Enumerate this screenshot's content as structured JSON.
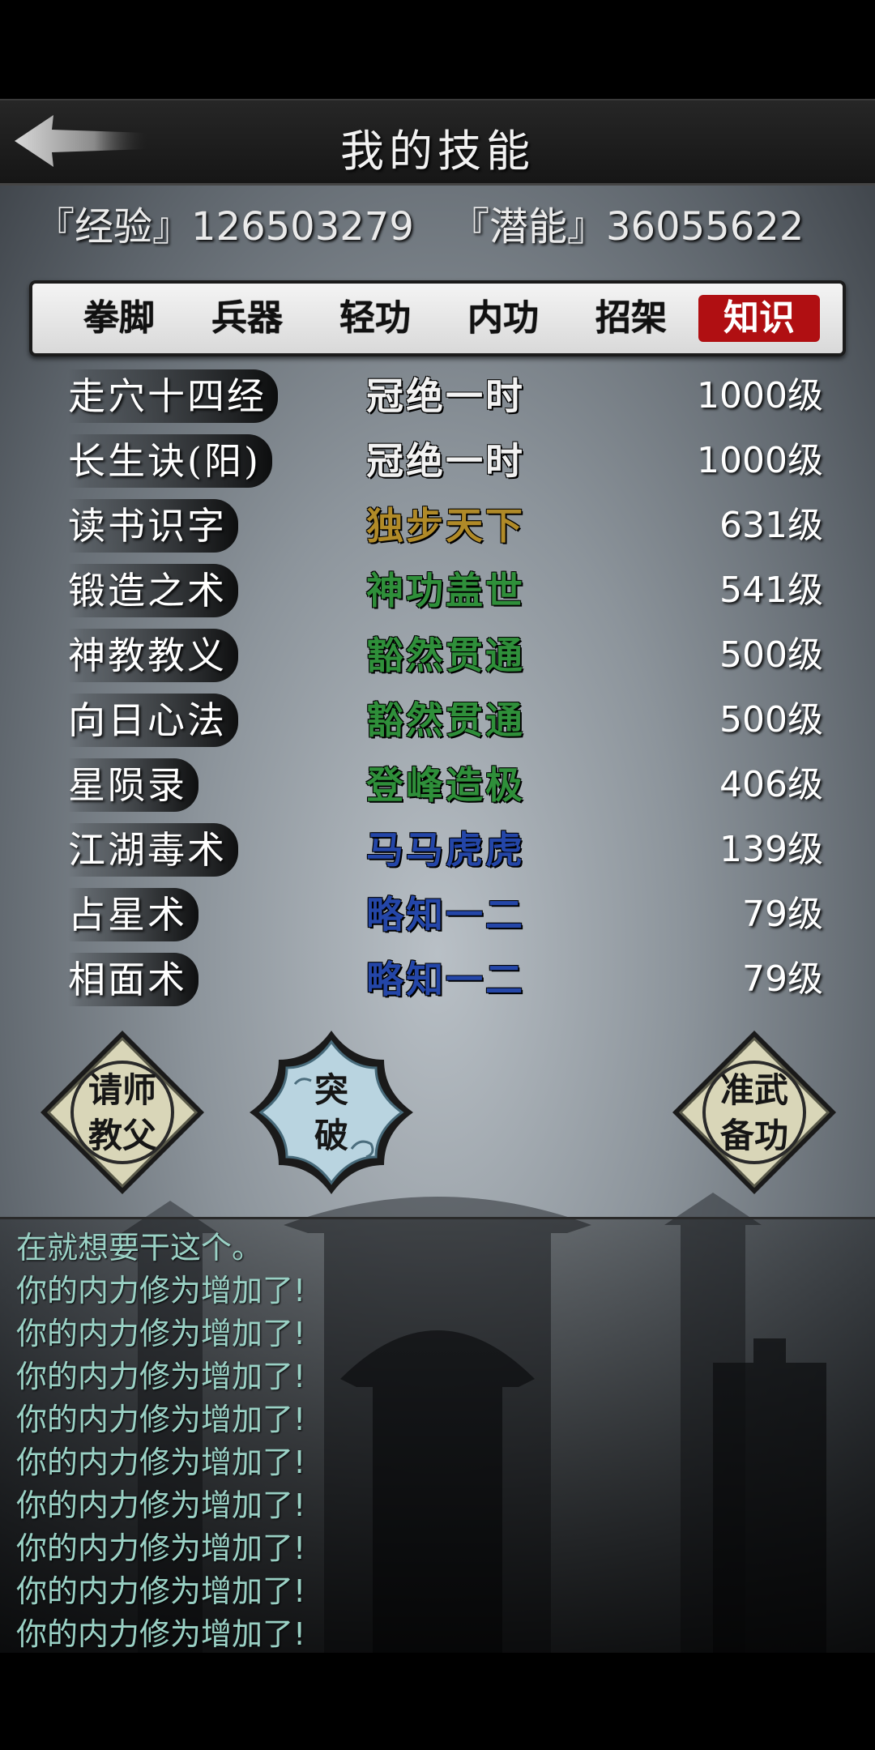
{
  "header": {
    "title": "我的技能"
  },
  "stats": {
    "exp": "『经验』126503279",
    "potential": "『潜能』36055622"
  },
  "tabs": [
    {
      "label": "拳脚",
      "active": false
    },
    {
      "label": "兵器",
      "active": false
    },
    {
      "label": "轻功",
      "active": false
    },
    {
      "label": "内功",
      "active": false
    },
    {
      "label": "招架",
      "active": false
    },
    {
      "label": "知识",
      "active": true
    }
  ],
  "skills": [
    {
      "name": "走穴十四经",
      "rank": "冠绝一时",
      "level": "1000级",
      "rank_color": "#f2f2f2"
    },
    {
      "name": "长生诀(阳)",
      "rank": "冠绝一时",
      "level": "1000级",
      "rank_color": "#f2f2f2"
    },
    {
      "name": "读书识字",
      "rank": "独步天下",
      "level": "631级",
      "rank_color": "#b08a28"
    },
    {
      "name": "锻造之术",
      "rank": "神功盖世",
      "level": "541级",
      "rank_color": "#2f8f3a"
    },
    {
      "name": "神教教义",
      "rank": "豁然贯通",
      "level": "500级",
      "rank_color": "#2f8f3a"
    },
    {
      "name": "向日心法",
      "rank": "豁然贯通",
      "level": "500级",
      "rank_color": "#2f8f3a"
    },
    {
      "name": "星陨录",
      "rank": "登峰造极",
      "level": "406级",
      "rank_color": "#2f8f3a"
    },
    {
      "name": "江湖毒术",
      "rank": "马马虎虎",
      "level": "139级",
      "rank_color": "#2446a8"
    },
    {
      "name": "占星术",
      "rank": "略知一二",
      "level": "79级",
      "rank_color": "#2446a8"
    },
    {
      "name": "相面术",
      "rank": "略知一二",
      "level": "79级",
      "rank_color": "#2446a8"
    }
  ],
  "actions": {
    "left": {
      "line1": "请师",
      "line2": "教父"
    },
    "center": {
      "line1": "突",
      "line2": "破"
    },
    "right": {
      "line1": "准武",
      "line2": "备功"
    }
  },
  "log": [
    "在就想要干这个。",
    "你的内力修为增加了!",
    "你的内力修为增加了!",
    "你的内力修为增加了!",
    "你的内力修为增加了!",
    "你的内力修为增加了!",
    "你的内力修为增加了!",
    "你的内力修为增加了!",
    "你的内力修为增加了!",
    "你的内力修为增加了!"
  ],
  "icons": {
    "back": "back-arrow-icon"
  }
}
